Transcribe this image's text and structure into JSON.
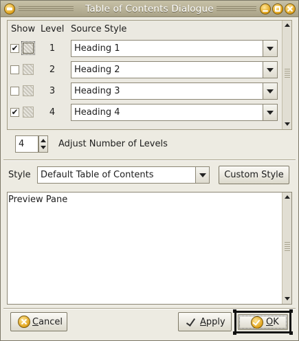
{
  "window": {
    "title": "Table of Contents Dialogue"
  },
  "levels": {
    "headers": {
      "show": "Show",
      "level": "Level",
      "source_style": "Source Style"
    },
    "rows": [
      {
        "checked": "✔",
        "level": "1",
        "style": "Heading 1"
      },
      {
        "checked": "",
        "level": "2",
        "style": "Heading 2"
      },
      {
        "checked": "",
        "level": "3",
        "style": "Heading 3"
      },
      {
        "checked": "✔",
        "level": "4",
        "style": "Heading 4"
      }
    ]
  },
  "adjust": {
    "value": "4",
    "label": "Adjust Number of Levels"
  },
  "style": {
    "label": "Style",
    "value": "Default Table of Contents",
    "custom_button": "Custom Style"
  },
  "preview": {
    "text": "Preview Pane"
  },
  "buttons": {
    "cancel_first": "C",
    "cancel_rest": "ancel",
    "apply_first": "A",
    "apply_rest": "pply",
    "ok_first": "O",
    "ok_rest": "K"
  },
  "icons": {
    "window_menu": "window-menu-icon",
    "minimize": "minimize-icon",
    "maximize": "maximize-icon",
    "close": "close-icon",
    "cancel": "cancel-icon",
    "apply": "checkmark-icon",
    "ok": "ok-icon"
  },
  "colors": {
    "accent": "#e0a21a",
    "titlebar": "#b5ae93",
    "background": "#edebe2"
  }
}
